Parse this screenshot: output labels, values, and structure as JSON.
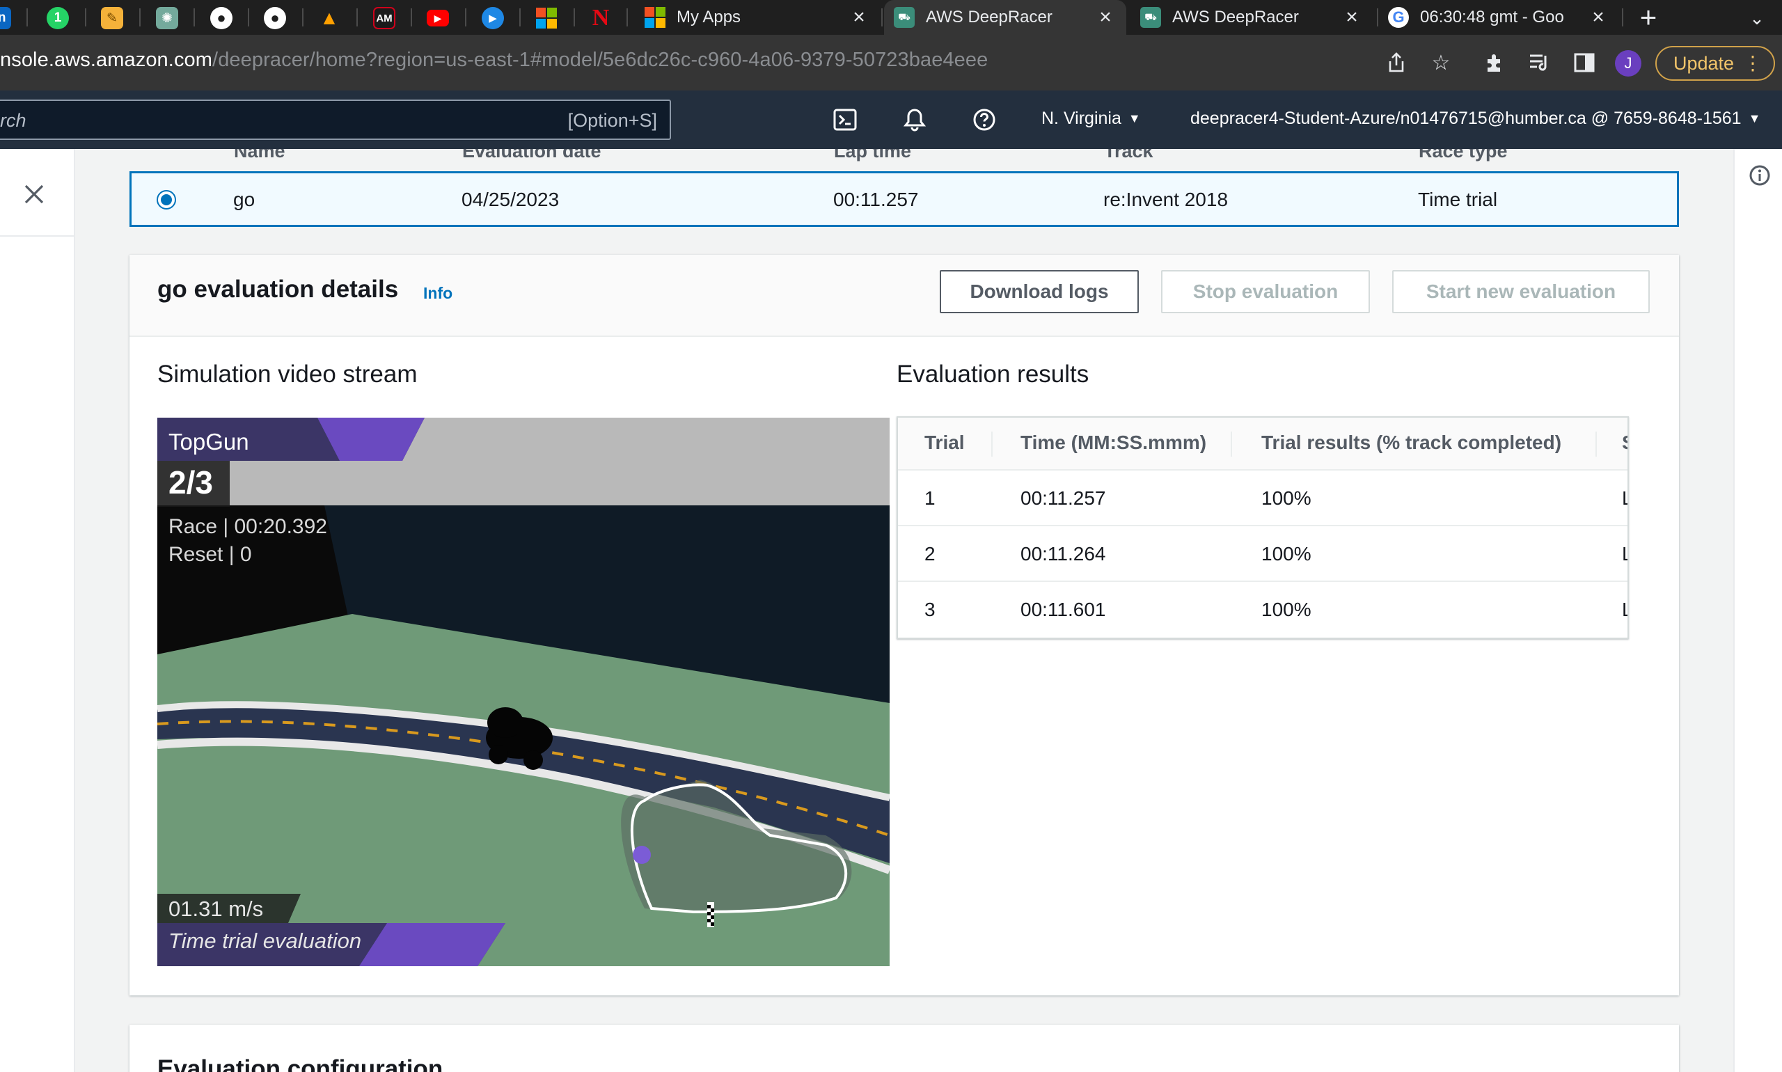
{
  "browser": {
    "pinned_tabs": [
      {
        "icon": "linkedin-icon",
        "glyph": "in",
        "color": "#0a66c2"
      },
      {
        "icon": "whatsapp-icon",
        "glyph": "1",
        "color": "#25d366"
      },
      {
        "icon": "notes-icon",
        "glyph": "✎",
        "color": "#f5b23a"
      },
      {
        "icon": "openai-icon",
        "glyph": "✺",
        "color": "#74aa9c"
      },
      {
        "icon": "github-icon",
        "glyph": "●",
        "color": "#ffffff"
      },
      {
        "icon": "github-icon",
        "glyph": "●",
        "color": "#ffffff"
      },
      {
        "icon": "firebase-icon",
        "glyph": "▲",
        "color": "#ffa000"
      },
      {
        "icon": "am-icon",
        "glyph": "AM",
        "color": "#d0021b"
      },
      {
        "icon": "youtube-icon",
        "glyph": "▶",
        "color": "#ff0000"
      },
      {
        "icon": "play-icon",
        "glyph": "▶",
        "color": "#1e88e5"
      },
      {
        "icon": "microsoft-icon",
        "glyph": "",
        "color": "#f25022"
      },
      {
        "icon": "netflix-icon",
        "glyph": "N",
        "color": "#e50914"
      }
    ],
    "tabs": [
      {
        "title": "My Apps",
        "icon": "microsoft-icon"
      },
      {
        "title": "AWS DeepRacer",
        "icon": "deepracer-icon"
      },
      {
        "title": "AWS DeepRacer",
        "icon": "deepracer-icon"
      },
      {
        "title": "06:30:48 gmt - Goo",
        "icon": "google-icon"
      }
    ],
    "url_host": "nsole.aws.amazon.com",
    "url_path": "/deepracer/home?region=us-east-1#model/5e6dc26c-c960-4a06-9379-50723bae4eee",
    "profile_initial": "J",
    "update_label": "Update"
  },
  "aws_nav": {
    "search_placeholder": "rch",
    "search_shortcut": "[Option+S]",
    "region": "N. Virginia",
    "account": "deepracer4-Student-Azure/n01476715@humber.ca @ 7659-8648-1561"
  },
  "evaluation_row": {
    "name": "go",
    "date": "04/25/2023",
    "lap_time": "00:11.257",
    "track": "re:Invent 2018",
    "race_type": "Time trial"
  },
  "details": {
    "title": "go evaluation details",
    "info": "Info",
    "download_logs": "Download logs",
    "stop_evaluation": "Stop evaluation",
    "start_new_evaluation": "Start new evaluation",
    "sim_title": "Simulation video stream",
    "results_title": "Evaluation results"
  },
  "video": {
    "racer": "TopGun",
    "lap": "2/3",
    "race": "Race | 00:20.392",
    "reset": "Reset | 0",
    "speed": "01.31 m/s",
    "mode": "Time trial evaluation"
  },
  "results": {
    "headers": [
      "Trial",
      "Time (MM:SS.mmm)",
      "Trial results (% track completed)",
      "S"
    ],
    "rows": [
      {
        "trial": "1",
        "time": "00:11.257",
        "completed": "100%",
        "status": "L"
      },
      {
        "trial": "2",
        "time": "00:11.264",
        "completed": "100%",
        "status": "L"
      },
      {
        "trial": "3",
        "time": "00:11.601",
        "completed": "100%",
        "status": "L"
      }
    ]
  },
  "config": {
    "title": "Evaluation configuration"
  },
  "colors": {
    "aws_nav_bg": "#232f3e",
    "accent": "#0073bb",
    "update_border": "#d1a24a"
  }
}
